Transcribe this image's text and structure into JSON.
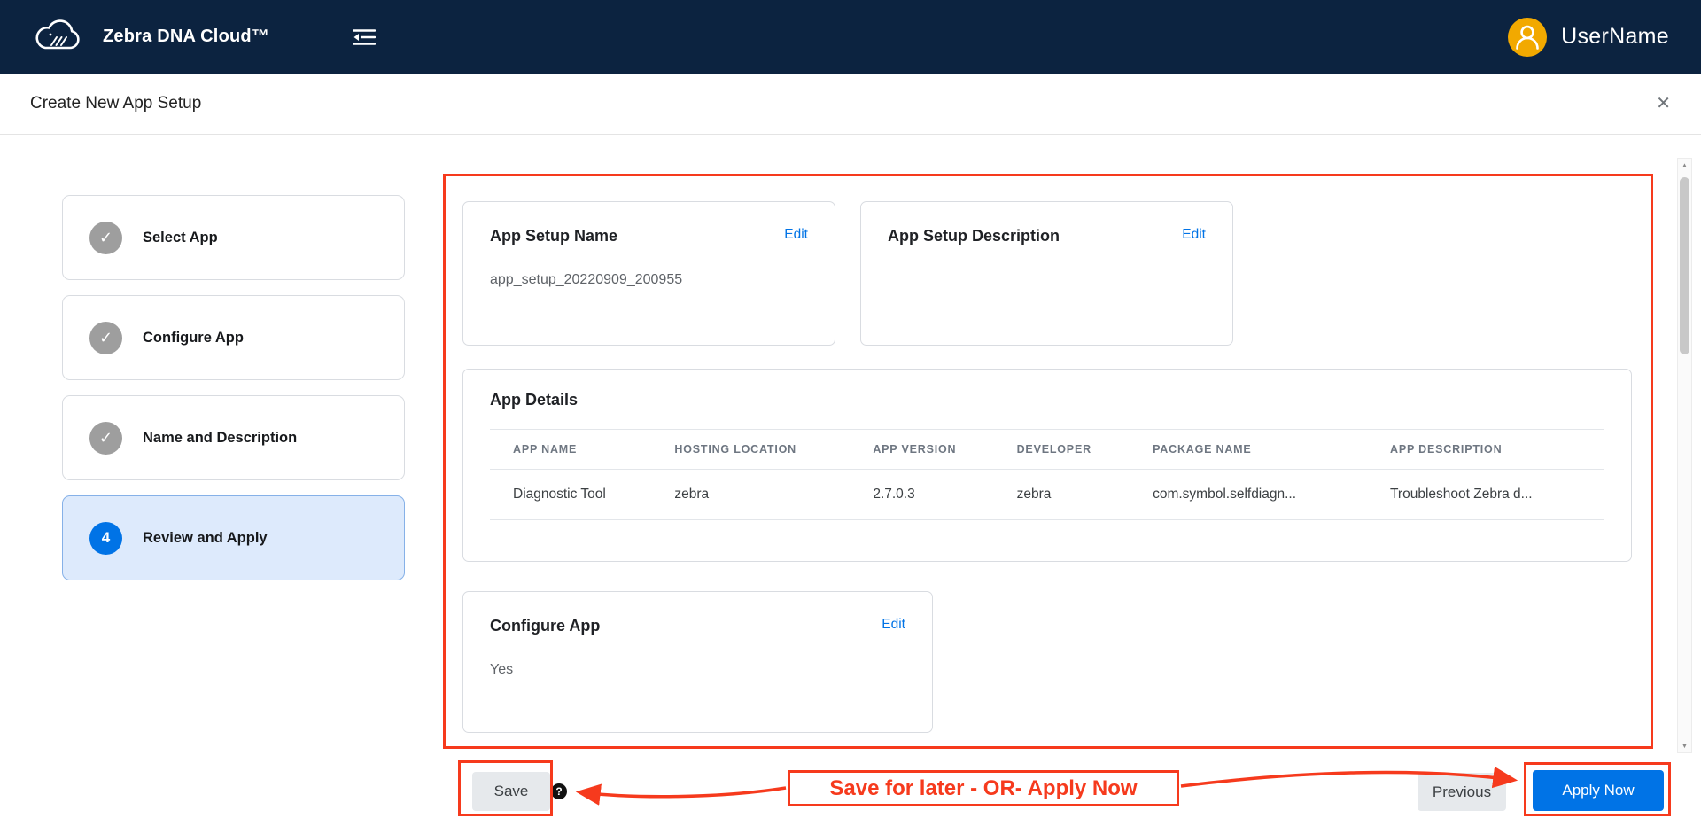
{
  "navbar": {
    "brand": "Zebra DNA Cloud™",
    "username": "UserName"
  },
  "header": {
    "title": "Create New App Setup"
  },
  "icons": {
    "check": "✓",
    "close": "✕",
    "help": "?",
    "scroll_up": "▲",
    "scroll_down": "▼"
  },
  "wizard": {
    "steps": [
      {
        "label": "Select App",
        "status": "done"
      },
      {
        "label": "Configure App",
        "status": "done"
      },
      {
        "label": "Name and Description",
        "status": "done"
      },
      {
        "label": "Review and Apply",
        "status": "active",
        "number": "4"
      }
    ]
  },
  "review": {
    "app_setup_name": {
      "title": "App Setup Name",
      "edit": "Edit",
      "value": "app_setup_20220909_200955"
    },
    "app_setup_description": {
      "title": "App Setup Description",
      "edit": "Edit",
      "value": ""
    },
    "app_details": {
      "title": "App Details",
      "columns": [
        "APP NAME",
        "HOSTING LOCATION",
        "APP VERSION",
        "DEVELOPER",
        "PACKAGE NAME",
        "APP DESCRIPTION"
      ],
      "rows": [
        [
          "Diagnostic Tool",
          "zebra",
          "2.7.0.3",
          "zebra",
          "com.symbol.selfdiagn...",
          "Troubleshoot Zebra d..."
        ]
      ]
    },
    "configure_app": {
      "title": "Configure App",
      "edit": "Edit",
      "value": "Yes"
    }
  },
  "footer": {
    "save": "Save",
    "previous": "Previous",
    "apply_now": "Apply Now",
    "annotation": "Save for later - OR-  Apply Now"
  },
  "colors": {
    "navbar_bg": "#0c2340",
    "accent_blue": "#0073e6",
    "annotation_red": "#f63a1d",
    "avatar_orange": "#f2a900",
    "step_done_gray": "#9e9e9e",
    "active_step_bg": "#ddeafc"
  }
}
